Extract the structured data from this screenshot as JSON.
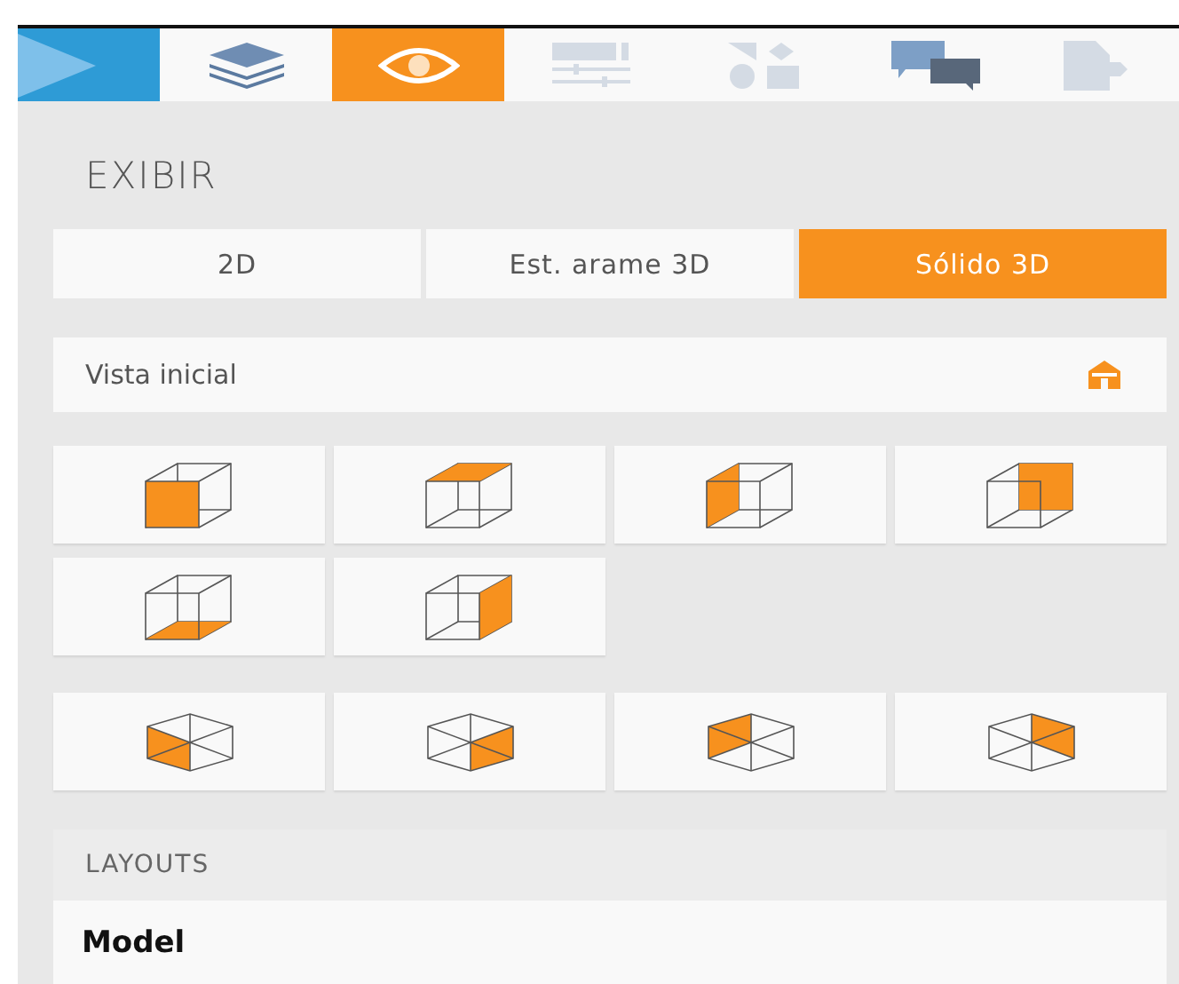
{
  "toolbar": [
    {
      "kind": "play",
      "selected": false,
      "disabled": false
    },
    {
      "kind": "layers",
      "selected": false,
      "disabled": false
    },
    {
      "kind": "eye",
      "selected": true,
      "disabled": false
    },
    {
      "kind": "properties",
      "selected": false,
      "disabled": true
    },
    {
      "kind": "shapes",
      "selected": false,
      "disabled": true
    },
    {
      "kind": "chat",
      "selected": false,
      "disabled": false
    },
    {
      "kind": "document",
      "selected": false,
      "disabled": true
    }
  ],
  "title": "EXIBIR",
  "modes": [
    {
      "label": "2D",
      "selected": false
    },
    {
      "label": "Est. arame 3D",
      "selected": false
    },
    {
      "label": "Sólido 3D",
      "selected": true
    }
  ],
  "home_view": {
    "label": "Vista inicial"
  },
  "face_views": [
    {
      "kind": "front"
    },
    {
      "kind": "top"
    },
    {
      "kind": "left"
    },
    {
      "kind": "back"
    },
    {
      "kind": "bottom"
    },
    {
      "kind": "right"
    }
  ],
  "corner_views": [
    {
      "kind": "front-left"
    },
    {
      "kind": "front-right"
    },
    {
      "kind": "back-left"
    },
    {
      "kind": "back-right"
    }
  ],
  "layouts": {
    "header": "LAYOUTS",
    "items": [
      {
        "label": "Model"
      }
    ]
  }
}
